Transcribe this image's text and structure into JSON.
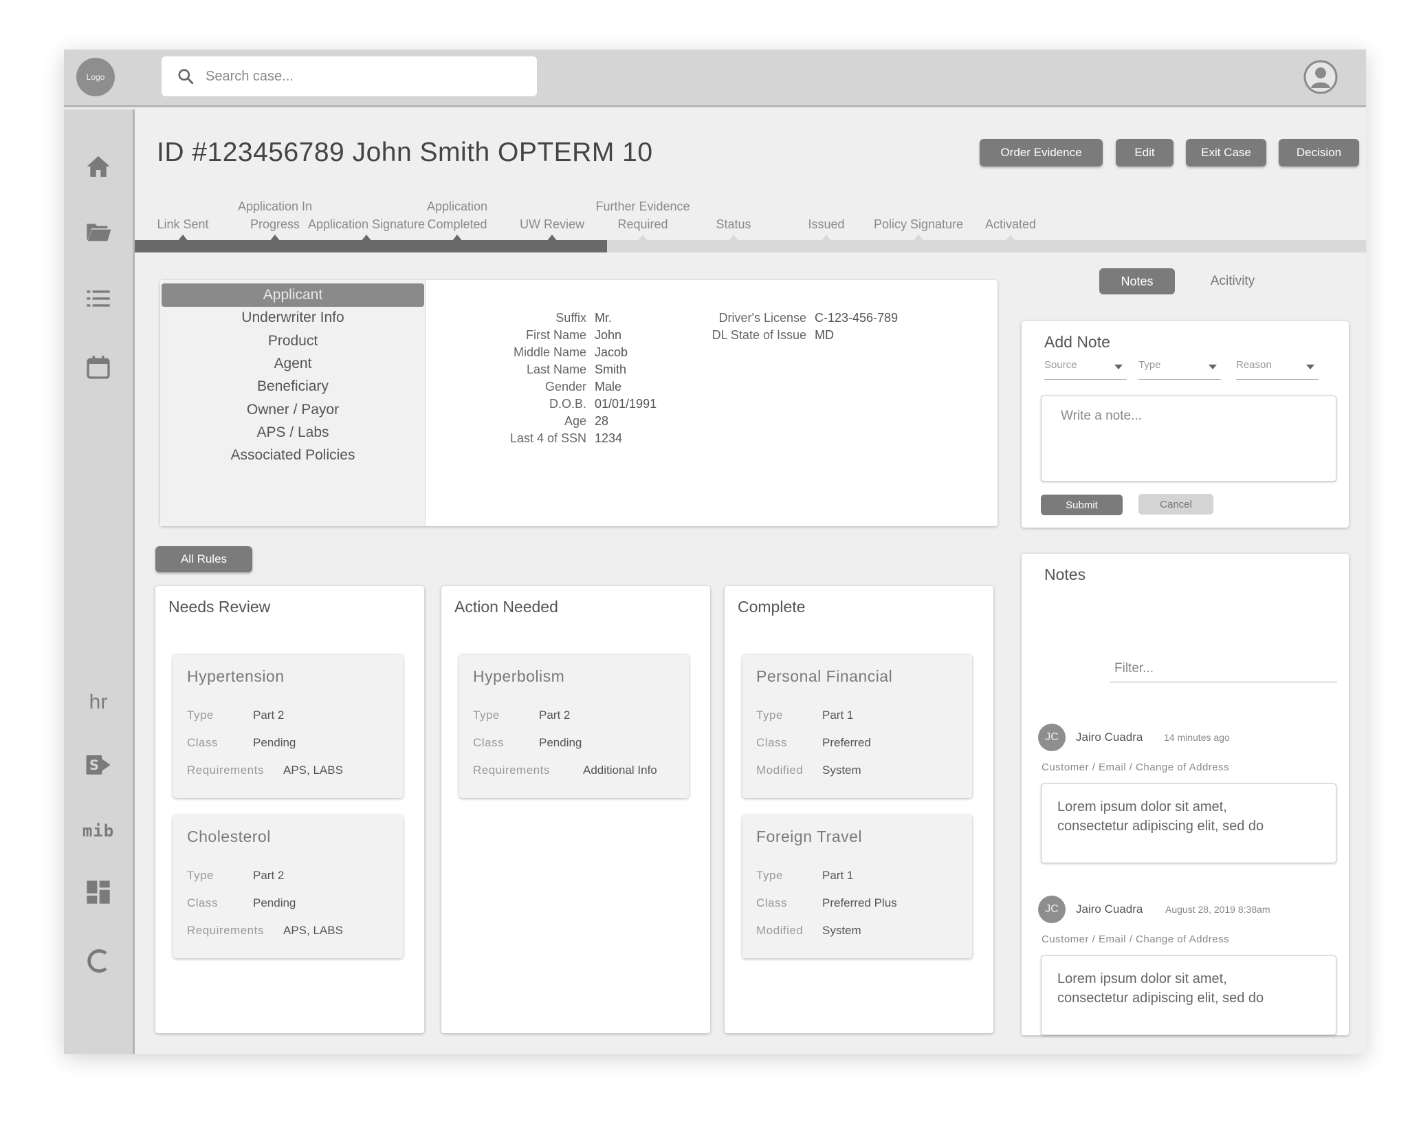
{
  "header": {
    "logo": "Logo",
    "search_placeholder": "Search case..."
  },
  "sidebar": {
    "items": [
      "home-icon",
      "folder-open-icon",
      "list-icon",
      "calendar-icon"
    ],
    "apps": [
      "hr",
      "mib"
    ]
  },
  "case": {
    "title": "ID #123456789 John Smith OPTERM 10",
    "buttons": {
      "order_evidence": "Order Evidence",
      "edit": "Edit",
      "exit_case": "Exit Case",
      "decision": "Decision"
    }
  },
  "progress": {
    "steps": [
      "Link Sent",
      "Application In Progress",
      "Application Signature",
      "Application Completed",
      "UW Review",
      "Further Evidence Required",
      "Status",
      "Issued",
      "Policy Signature",
      "Activated"
    ],
    "completed_steps": 5
  },
  "applicant": {
    "nav": [
      "Applicant",
      "Underwriter Info",
      "Product",
      "Agent",
      "Beneficiary",
      "Owner / Payor",
      "APS / Labs",
      "Associated Policies"
    ],
    "active": "Applicant",
    "fields": [
      {
        "label": "Suffix",
        "value": "Mr."
      },
      {
        "label": "First Name",
        "value": "John"
      },
      {
        "label": "Middle Name",
        "value": "Jacob"
      },
      {
        "label": "Last Name",
        "value": "Smith"
      },
      {
        "label": "Gender",
        "value": "Male"
      },
      {
        "label": "D.O.B.",
        "value": "01/01/1991"
      },
      {
        "label": "Age",
        "value": "28"
      },
      {
        "label": "Last 4 of SSN",
        "value": "1234"
      }
    ],
    "fields_right": [
      {
        "label": "Driver's License",
        "value": "C-123-456-789"
      },
      {
        "label": "DL State of Issue",
        "value": "MD"
      }
    ]
  },
  "panel_tabs": {
    "notes": "Notes",
    "activity": "Acitivity"
  },
  "add_note": {
    "title": "Add Note",
    "source": "Source",
    "type": "Type",
    "reason": "Reason",
    "placeholder": "Write a note...",
    "submit": "Submit",
    "cancel": "Cancel"
  },
  "notes": {
    "title": "Notes",
    "filter_placeholder": "Filter...",
    "items": [
      {
        "initials": "JC",
        "author": "Jairo Cuadra",
        "time": "14 minutes ago",
        "crumb": "Customer /  Email / Change of Address",
        "text_line1": "Lorem ipsum dolor sit amet,",
        "text_line2": "consectetur adipiscing elit, sed do"
      },
      {
        "initials": "JC",
        "author": "Jairo Cuadra",
        "time": "August 28, 2019 8:38am",
        "crumb": "Customer /  Email / Change of Address",
        "text_line1": "Lorem ipsum dolor sit amet,",
        "text_line2": "consectetur adipiscing elit, sed do"
      }
    ]
  },
  "rules": {
    "all_rules": "All Rules",
    "columns": [
      {
        "title": "Needs Review",
        "cards": [
          {
            "name": "Hypertension",
            "rows": [
              [
                "Type",
                "Part 2"
              ],
              [
                "Class",
                "Pending"
              ],
              [
                "Requirements",
                "APS, LABS"
              ]
            ]
          },
          {
            "name": "Cholesterol",
            "rows": [
              [
                "Type",
                "Part 2"
              ],
              [
                "Class",
                "Pending"
              ],
              [
                "Requirements",
                "APS, LABS"
              ]
            ]
          }
        ]
      },
      {
        "title": "Action Needed",
        "cards": [
          {
            "name": "Hyperbolism",
            "rows": [
              [
                "Type",
                "Part 2"
              ],
              [
                "Class",
                "Pending"
              ],
              [
                "Requirements",
                "Additional Info"
              ]
            ]
          }
        ]
      },
      {
        "title": "Complete",
        "cards": [
          {
            "name": "Personal Financial",
            "rows": [
              [
                "Type",
                "Part 1"
              ],
              [
                "Class",
                "Preferred"
              ],
              [
                "Modified",
                "System"
              ]
            ]
          },
          {
            "name": "Foreign Travel",
            "rows": [
              [
                "Type",
                "Part 1"
              ],
              [
                "Class",
                "Preferred Plus"
              ],
              [
                "Modified",
                "System"
              ]
            ]
          }
        ]
      }
    ]
  }
}
